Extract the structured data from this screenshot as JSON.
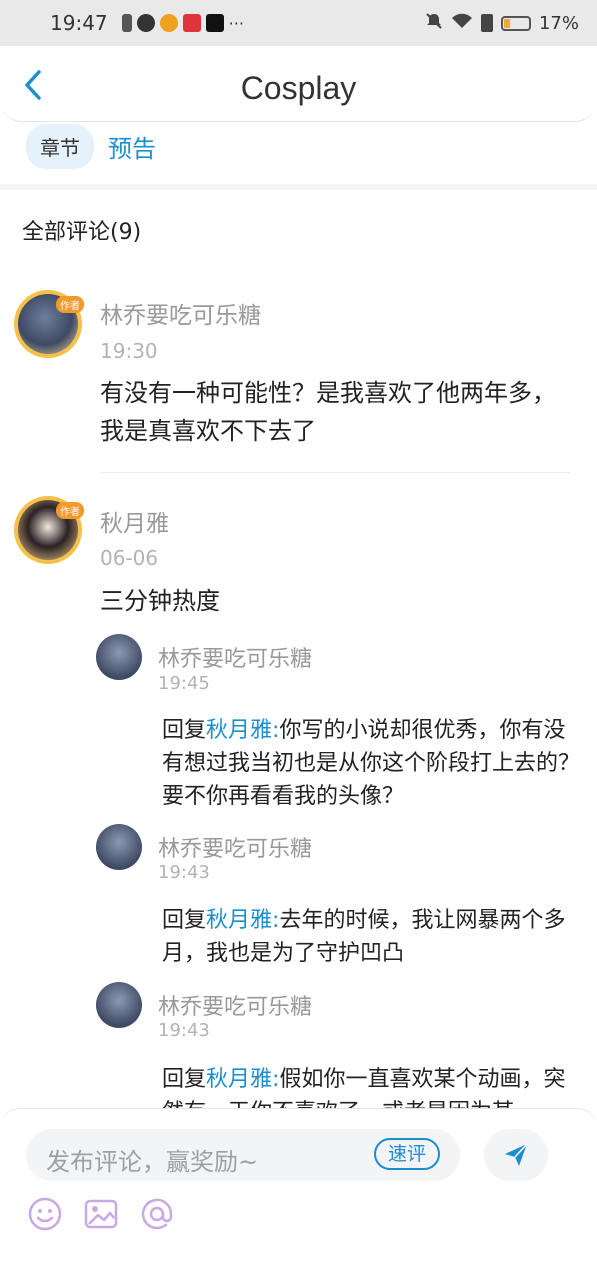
{
  "status_bar": {
    "time": "19:47",
    "dots": "···",
    "battery": "17%"
  },
  "header": {
    "title": "Cosplay"
  },
  "tabs": {
    "chapter": "章节",
    "preview": "预告"
  },
  "comments_title": "全部评论(9)",
  "comments": [
    {
      "name": "林乔要吃可乐糖",
      "time": "19:30",
      "text": "有没有一种可能性？是我喜欢了他两年多，我是真喜欢不下去了",
      "badge": "作者"
    },
    {
      "name": "秋月雅",
      "time": "06-06",
      "text": "三分钟热度",
      "badge": "作者"
    }
  ],
  "replies": [
    {
      "name": "林乔要吃可乐糖",
      "time": "19:45",
      "prefix": "回复",
      "target": "秋月雅:",
      "text": "你写的小说却很优秀，你有没有想过我当初也是从你这个阶段打上去的？要不你再看看我的头像？"
    },
    {
      "name": "林乔要吃可乐糖",
      "time": "19:43",
      "prefix": "回复",
      "target": "秋月雅:",
      "text": "去年的时候，我让网暴两个多月，我也是为了守护凹凸"
    },
    {
      "name": "林乔要吃可乐糖",
      "time": "19:43",
      "prefix": "回复",
      "target": "秋月雅:",
      "text": "假如你一直喜欢某个动画，突然有一天你不喜欢了，或者是因为某"
    }
  ],
  "bottom_bar": {
    "placeholder": "发布评论，赢奖励~",
    "quick_review": "速评"
  },
  "colors": {
    "accent": "#1a8ecf",
    "badge": "#f39a2a"
  }
}
